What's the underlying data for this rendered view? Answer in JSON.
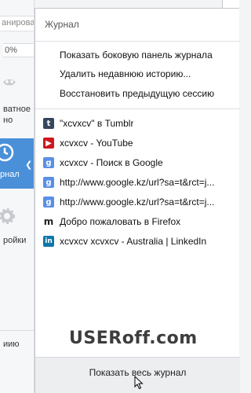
{
  "sidebar_fragments": {
    "top_text": "анирова...",
    "zoom": "0%",
    "private_1": "ватное",
    "private_2": "но",
    "history": "рнал",
    "settings": "ройки",
    "bottom": "иию"
  },
  "panel": {
    "title": "Журнал",
    "menu": [
      "Показать боковую панель журнала",
      "Удалить недавнюю историю...",
      "Восстановить предыдущую сессию"
    ],
    "history": [
      {
        "icon": "tumblr-icon",
        "label": "\"xcvxcv\" в Tumblr"
      },
      {
        "icon": "youtube-icon",
        "label": "xcvxcv - YouTube"
      },
      {
        "icon": "google-icon",
        "label": "xcvxcv - Поиск в Google"
      },
      {
        "icon": "google-icon",
        "label": "http://www.google.kz/url?sa=t&rct=j..."
      },
      {
        "icon": "google-icon",
        "label": "http://www.google.kz/url?sa=t&rct=j..."
      },
      {
        "icon": "mozilla-icon",
        "label": "Добро пожаловать в Firefox"
      },
      {
        "icon": "linkedin-icon",
        "label": "xcvxcv xcvxcv - Australia | LinkedIn"
      }
    ],
    "show_all": "Показать весь журнал"
  },
  "watermark": "USERoff.com",
  "colors": {
    "active": "#4a90d9",
    "panel_bg": "#ffffff",
    "footer_bg": "#eceef0"
  }
}
